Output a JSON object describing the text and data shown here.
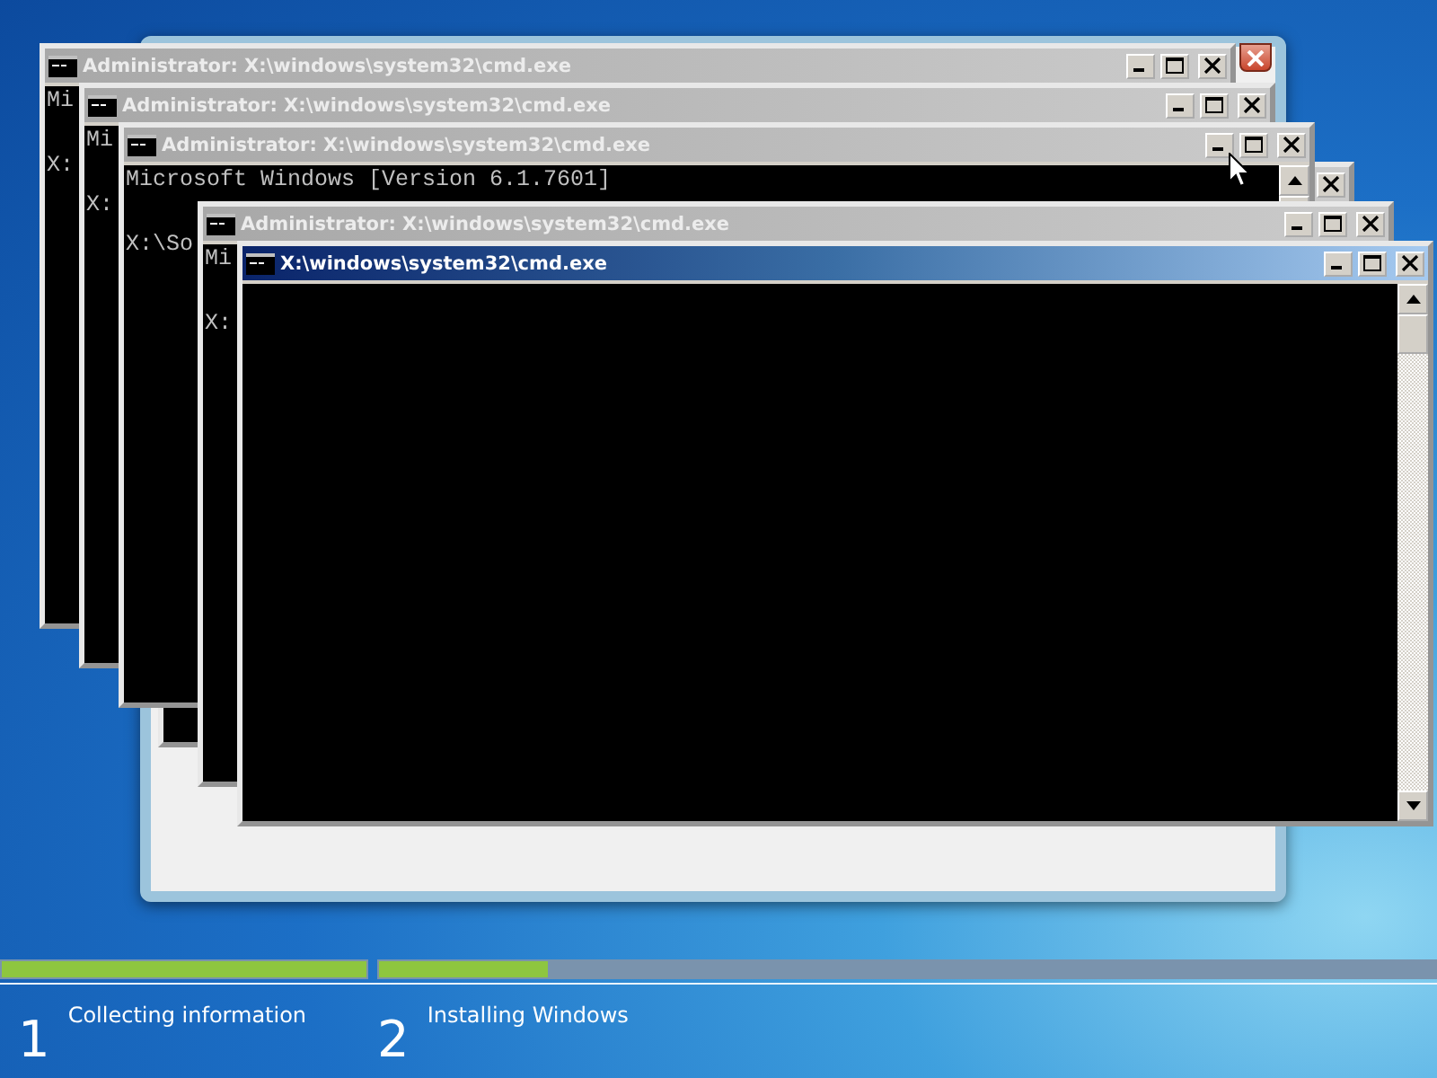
{
  "windows": [
    {
      "title": "Administrator: X:\\windows\\system32\\cmd.exe",
      "active": false,
      "output": [
        "Mi"
      ],
      "prompt": "X:"
    },
    {
      "title": "Administrator: X:\\windows\\system32\\cmd.exe",
      "active": false,
      "output": [
        "Mi"
      ],
      "prompt": "X:"
    },
    {
      "active": false
    },
    {
      "title": "Administrator: X:\\windows\\system32\\cmd.exe",
      "active": false,
      "output": [
        "Microsoft Windows [Version 6.1.7601]"
      ],
      "prompt": "X:\\So"
    },
    {
      "title": "Administrator: X:\\windows\\system32\\cmd.exe",
      "active": false,
      "output": [
        "Mi"
      ],
      "prompt": "X:"
    },
    {
      "title": "X:\\windows\\system32\\cmd.exe",
      "active": true
    }
  ],
  "setup_progress": {
    "steps": [
      {
        "number": "1",
        "label": "Collecting information",
        "level": 1
      },
      {
        "number": "2",
        "label": "Installing Windows",
        "level": 0.16
      }
    ]
  }
}
